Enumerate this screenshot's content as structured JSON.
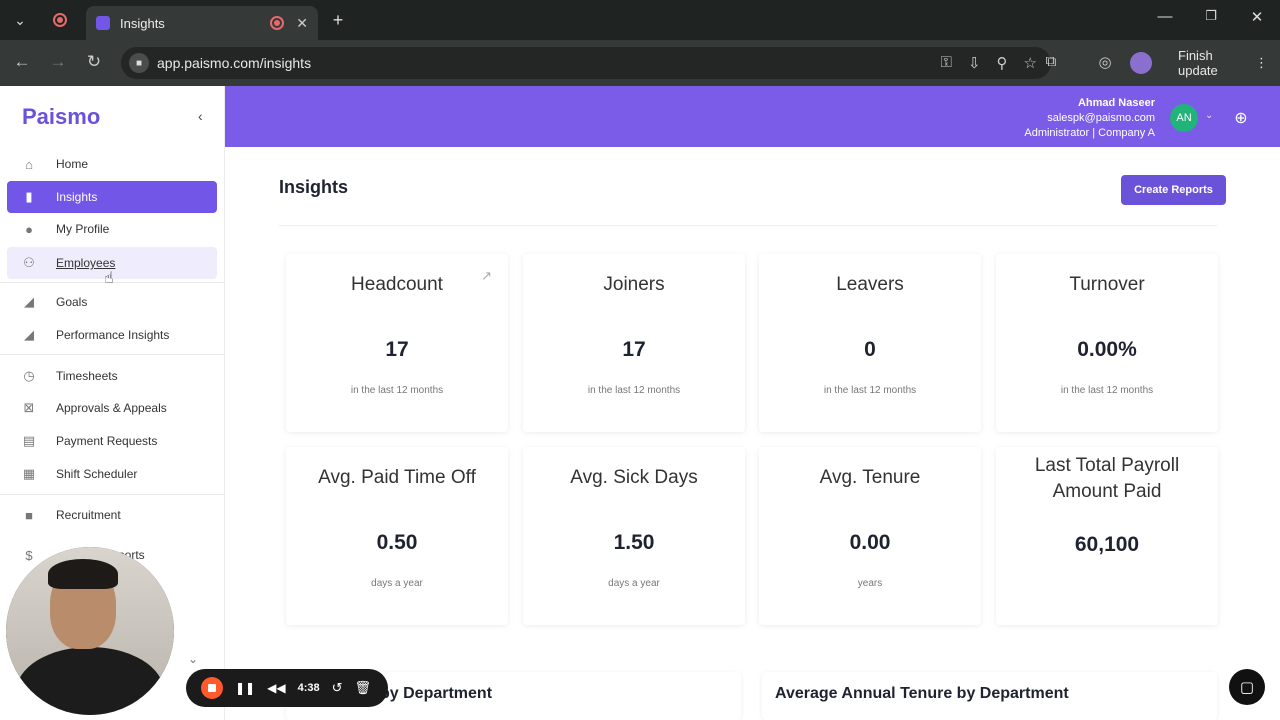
{
  "browser": {
    "tab_title": "Insights",
    "url": "app.paismo.com/insights",
    "finish_update_label": "Finish update"
  },
  "sidebar": {
    "logo": "Paismo",
    "items": [
      {
        "label": "Home",
        "icon": "home-icon"
      },
      {
        "label": "Insights",
        "icon": "bar-chart-icon"
      },
      {
        "label": "My Profile",
        "icon": "person-icon"
      },
      {
        "label": "Employees",
        "icon": "people-icon"
      },
      {
        "label": "Goals",
        "icon": "goal-icon"
      },
      {
        "label": "Performance Insights",
        "icon": "performance-icon"
      },
      {
        "label": "Timesheets",
        "icon": "stopwatch-icon"
      },
      {
        "label": "Approvals & Appeals",
        "icon": "calendar-x-icon"
      },
      {
        "label": "Payment Requests",
        "icon": "payment-icon"
      },
      {
        "label": "Shift Scheduler",
        "icon": "calendar-icon"
      },
      {
        "label": "Recruitment",
        "icon": "briefcase-icon"
      },
      {
        "label": "ports",
        "icon": "dollar-icon"
      }
    ]
  },
  "header": {
    "user_name": "Ahmad Naseer",
    "user_email": "salespk@paismo.com",
    "user_role": "Administrator | Company A",
    "avatar_initials": "AN"
  },
  "main": {
    "title": "Insights",
    "create_button": "Create Reports",
    "cards": [
      {
        "title": "Headcount",
        "value": "17",
        "sub": "in the last 12 months"
      },
      {
        "title": "Joiners",
        "value": "17",
        "sub": "in the last 12 months"
      },
      {
        "title": "Leavers",
        "value": "0",
        "sub": "in the last 12 months"
      },
      {
        "title": "Turnover",
        "value": "0.00%",
        "sub": "in the last 12 months"
      },
      {
        "title": "Avg. Paid Time Off",
        "value": "0.50",
        "sub": "days a year"
      },
      {
        "title": "Avg. Sick Days",
        "value": "1.50",
        "sub": "days a year"
      },
      {
        "title": "Avg. Tenure",
        "value": "0.00",
        "sub": "years"
      },
      {
        "title": "Last Total Payroll Amount Paid",
        "value": "60,100",
        "sub": ""
      }
    ],
    "section_left": "by Department",
    "section_right": "Average Annual Tenure by Department"
  },
  "recorder": {
    "time": "4:38"
  },
  "colors": {
    "brand": "#7a5ce8",
    "button": "#6a52d9",
    "active_nav": "#7156e8"
  }
}
